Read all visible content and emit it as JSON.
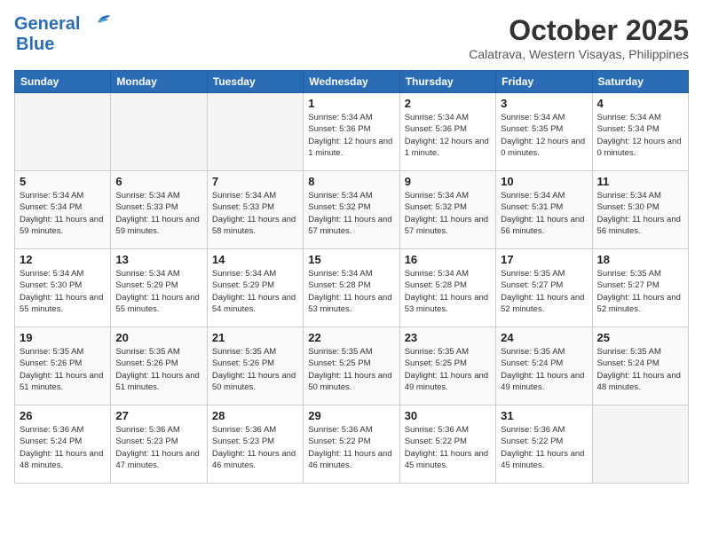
{
  "header": {
    "logo_general": "General",
    "logo_blue": "Blue",
    "month": "October 2025",
    "location": "Calatrava, Western Visayas, Philippines"
  },
  "weekdays": [
    "Sunday",
    "Monday",
    "Tuesday",
    "Wednesday",
    "Thursday",
    "Friday",
    "Saturday"
  ],
  "weeks": [
    [
      {
        "day": "",
        "sunrise": "",
        "sunset": "",
        "daylight": ""
      },
      {
        "day": "",
        "sunrise": "",
        "sunset": "",
        "daylight": ""
      },
      {
        "day": "",
        "sunrise": "",
        "sunset": "",
        "daylight": ""
      },
      {
        "day": "1",
        "sunrise": "Sunrise: 5:34 AM",
        "sunset": "Sunset: 5:36 PM",
        "daylight": "Daylight: 12 hours and 1 minute."
      },
      {
        "day": "2",
        "sunrise": "Sunrise: 5:34 AM",
        "sunset": "Sunset: 5:36 PM",
        "daylight": "Daylight: 12 hours and 1 minute."
      },
      {
        "day": "3",
        "sunrise": "Sunrise: 5:34 AM",
        "sunset": "Sunset: 5:35 PM",
        "daylight": "Daylight: 12 hours and 0 minutes."
      },
      {
        "day": "4",
        "sunrise": "Sunrise: 5:34 AM",
        "sunset": "Sunset: 5:34 PM",
        "daylight": "Daylight: 12 hours and 0 minutes."
      }
    ],
    [
      {
        "day": "5",
        "sunrise": "Sunrise: 5:34 AM",
        "sunset": "Sunset: 5:34 PM",
        "daylight": "Daylight: 11 hours and 59 minutes."
      },
      {
        "day": "6",
        "sunrise": "Sunrise: 5:34 AM",
        "sunset": "Sunset: 5:33 PM",
        "daylight": "Daylight: 11 hours and 59 minutes."
      },
      {
        "day": "7",
        "sunrise": "Sunrise: 5:34 AM",
        "sunset": "Sunset: 5:33 PM",
        "daylight": "Daylight: 11 hours and 58 minutes."
      },
      {
        "day": "8",
        "sunrise": "Sunrise: 5:34 AM",
        "sunset": "Sunset: 5:32 PM",
        "daylight": "Daylight: 11 hours and 57 minutes."
      },
      {
        "day": "9",
        "sunrise": "Sunrise: 5:34 AM",
        "sunset": "Sunset: 5:32 PM",
        "daylight": "Daylight: 11 hours and 57 minutes."
      },
      {
        "day": "10",
        "sunrise": "Sunrise: 5:34 AM",
        "sunset": "Sunset: 5:31 PM",
        "daylight": "Daylight: 11 hours and 56 minutes."
      },
      {
        "day": "11",
        "sunrise": "Sunrise: 5:34 AM",
        "sunset": "Sunset: 5:30 PM",
        "daylight": "Daylight: 11 hours and 56 minutes."
      }
    ],
    [
      {
        "day": "12",
        "sunrise": "Sunrise: 5:34 AM",
        "sunset": "Sunset: 5:30 PM",
        "daylight": "Daylight: 11 hours and 55 minutes."
      },
      {
        "day": "13",
        "sunrise": "Sunrise: 5:34 AM",
        "sunset": "Sunset: 5:29 PM",
        "daylight": "Daylight: 11 hours and 55 minutes."
      },
      {
        "day": "14",
        "sunrise": "Sunrise: 5:34 AM",
        "sunset": "Sunset: 5:29 PM",
        "daylight": "Daylight: 11 hours and 54 minutes."
      },
      {
        "day": "15",
        "sunrise": "Sunrise: 5:34 AM",
        "sunset": "Sunset: 5:28 PM",
        "daylight": "Daylight: 11 hours and 53 minutes."
      },
      {
        "day": "16",
        "sunrise": "Sunrise: 5:34 AM",
        "sunset": "Sunset: 5:28 PM",
        "daylight": "Daylight: 11 hours and 53 minutes."
      },
      {
        "day": "17",
        "sunrise": "Sunrise: 5:35 AM",
        "sunset": "Sunset: 5:27 PM",
        "daylight": "Daylight: 11 hours and 52 minutes."
      },
      {
        "day": "18",
        "sunrise": "Sunrise: 5:35 AM",
        "sunset": "Sunset: 5:27 PM",
        "daylight": "Daylight: 11 hours and 52 minutes."
      }
    ],
    [
      {
        "day": "19",
        "sunrise": "Sunrise: 5:35 AM",
        "sunset": "Sunset: 5:26 PM",
        "daylight": "Daylight: 11 hours and 51 minutes."
      },
      {
        "day": "20",
        "sunrise": "Sunrise: 5:35 AM",
        "sunset": "Sunset: 5:26 PM",
        "daylight": "Daylight: 11 hours and 51 minutes."
      },
      {
        "day": "21",
        "sunrise": "Sunrise: 5:35 AM",
        "sunset": "Sunset: 5:26 PM",
        "daylight": "Daylight: 11 hours and 50 minutes."
      },
      {
        "day": "22",
        "sunrise": "Sunrise: 5:35 AM",
        "sunset": "Sunset: 5:25 PM",
        "daylight": "Daylight: 11 hours and 50 minutes."
      },
      {
        "day": "23",
        "sunrise": "Sunrise: 5:35 AM",
        "sunset": "Sunset: 5:25 PM",
        "daylight": "Daylight: 11 hours and 49 minutes."
      },
      {
        "day": "24",
        "sunrise": "Sunrise: 5:35 AM",
        "sunset": "Sunset: 5:24 PM",
        "daylight": "Daylight: 11 hours and 49 minutes."
      },
      {
        "day": "25",
        "sunrise": "Sunrise: 5:35 AM",
        "sunset": "Sunset: 5:24 PM",
        "daylight": "Daylight: 11 hours and 48 minutes."
      }
    ],
    [
      {
        "day": "26",
        "sunrise": "Sunrise: 5:36 AM",
        "sunset": "Sunset: 5:24 PM",
        "daylight": "Daylight: 11 hours and 48 minutes."
      },
      {
        "day": "27",
        "sunrise": "Sunrise: 5:36 AM",
        "sunset": "Sunset: 5:23 PM",
        "daylight": "Daylight: 11 hours and 47 minutes."
      },
      {
        "day": "28",
        "sunrise": "Sunrise: 5:36 AM",
        "sunset": "Sunset: 5:23 PM",
        "daylight": "Daylight: 11 hours and 46 minutes."
      },
      {
        "day": "29",
        "sunrise": "Sunrise: 5:36 AM",
        "sunset": "Sunset: 5:22 PM",
        "daylight": "Daylight: 11 hours and 46 minutes."
      },
      {
        "day": "30",
        "sunrise": "Sunrise: 5:36 AM",
        "sunset": "Sunset: 5:22 PM",
        "daylight": "Daylight: 11 hours and 45 minutes."
      },
      {
        "day": "31",
        "sunrise": "Sunrise: 5:36 AM",
        "sunset": "Sunset: 5:22 PM",
        "daylight": "Daylight: 11 hours and 45 minutes."
      },
      {
        "day": "",
        "sunrise": "",
        "sunset": "",
        "daylight": ""
      }
    ]
  ]
}
